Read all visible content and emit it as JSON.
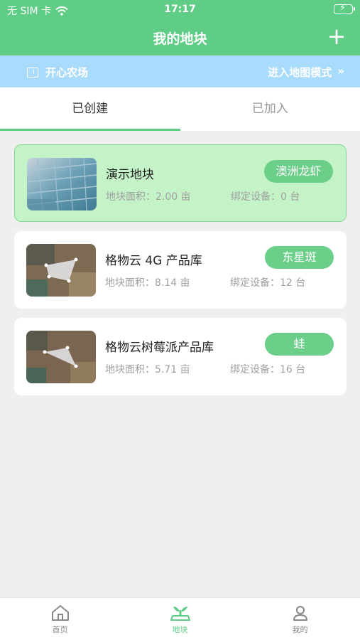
{
  "status_bar": {
    "carrier": "无 SIM 卡",
    "time": "17:17"
  },
  "nav": {
    "title": "我的地块",
    "add_label": "+"
  },
  "farm": {
    "name": "开心农场",
    "map_mode_label": "进入地图模式",
    "map_mode_arrow": "»"
  },
  "tabs": [
    {
      "label": "已创建",
      "active": true
    },
    {
      "label": "已加入",
      "active": false
    }
  ],
  "plots": [
    {
      "name": "演示地块",
      "tag": "澳洲龙虾",
      "area": "地块面积：2.00 亩",
      "devices": "绑定设备：0 台",
      "selected": true
    },
    {
      "name": "格物云 4G 产品库",
      "tag": "东星斑",
      "area": "地块面积：8.14 亩",
      "devices": "绑定设备：12 台",
      "selected": false
    },
    {
      "name": "格物云树莓派产品库",
      "tag": "蛙",
      "area": "地块面积：5.71 亩",
      "devices": "绑定设备：16 台",
      "selected": false
    }
  ],
  "bottom_tabs": [
    {
      "label": "首页",
      "icon": "home-icon",
      "active": false
    },
    {
      "label": "地块",
      "icon": "plot-icon",
      "active": true
    },
    {
      "label": "我的",
      "icon": "person-icon",
      "active": false
    }
  ],
  "colors": {
    "primary": "#5fcd85",
    "banner": "#a9dbfc",
    "selected_card": "#c5f3c8"
  }
}
